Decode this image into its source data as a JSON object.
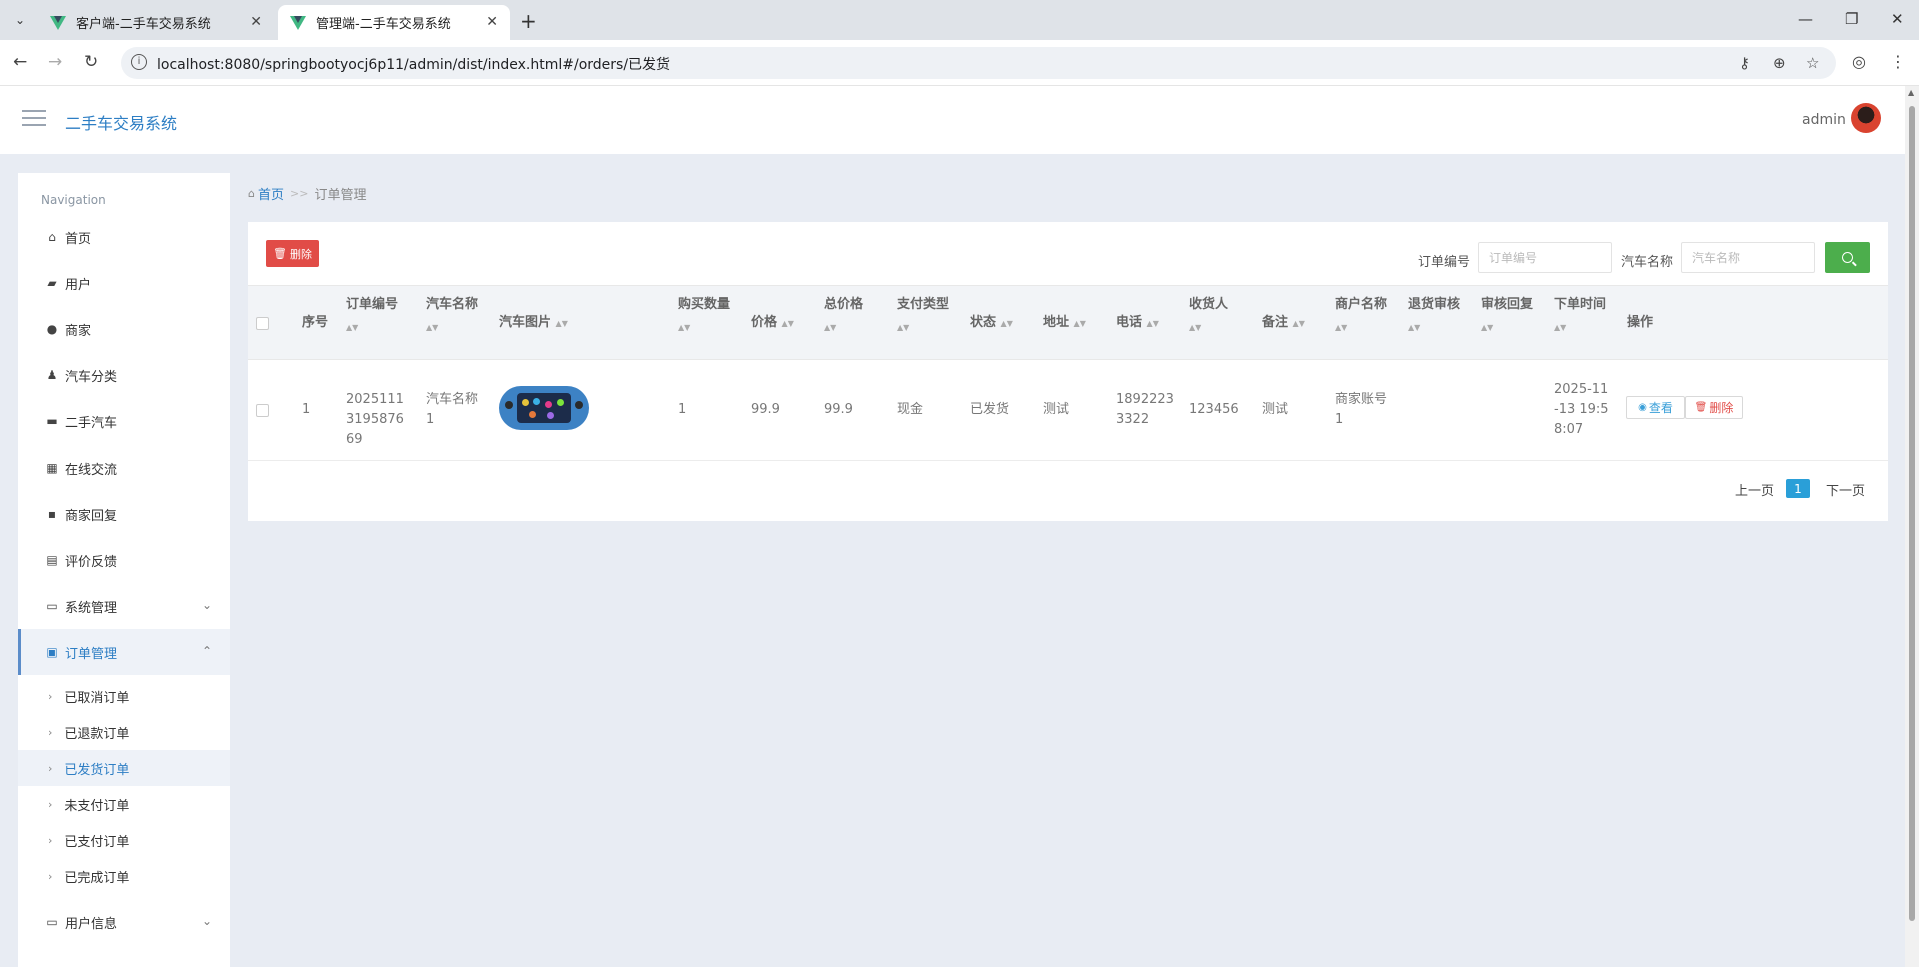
{
  "browser": {
    "tabs": [
      {
        "title": "客户端-二手车交易系统"
      },
      {
        "title": "管理端-二手车交易系统"
      }
    ],
    "url": "localhost:8080/springbootyocj6p11/admin/dist/index.html#/orders/已发货"
  },
  "header": {
    "app_title": "二手车交易系统",
    "user_name": "admin"
  },
  "sidebar": {
    "heading": "Navigation",
    "items": [
      {
        "label": "首页",
        "icon": "home-icon"
      },
      {
        "label": "用户",
        "icon": "briefcase-icon"
      },
      {
        "label": "商家",
        "icon": "globe-icon"
      },
      {
        "label": "汽车分类",
        "icon": "person-icon"
      },
      {
        "label": "二手汽车",
        "icon": "projector-icon"
      },
      {
        "label": "在线交流",
        "icon": "grid-icon"
      },
      {
        "label": "商家回复",
        "icon": "comment-icon"
      },
      {
        "label": "评价反馈",
        "icon": "clipboard-icon"
      },
      {
        "label": "系统管理",
        "icon": "laptop-icon"
      },
      {
        "label": "订单管理",
        "icon": "monitor-icon"
      },
      {
        "label": "用户信息",
        "icon": "card-icon"
      }
    ],
    "order_subitems": [
      "已取消订单",
      "已退款订单",
      "已发货订单",
      "未支付订单",
      "已支付订单",
      "已完成订单"
    ]
  },
  "breadcrumb": {
    "home": "首页",
    "separator": ">>",
    "current": "订单管理"
  },
  "toolbar": {
    "delete_label": "删除",
    "order_no_label": "订单编号",
    "order_no_placeholder": "订单编号",
    "car_name_label": "汽车名称",
    "car_name_placeholder": "汽车名称"
  },
  "table": {
    "columns": [
      "序号",
      "订单编号",
      "汽车名称",
      "汽车图片",
      "购买数量",
      "价格",
      "总价格",
      "支付类型",
      "状态",
      "地址",
      "电话",
      "收货人",
      "备注",
      "商户名称",
      "退货审核",
      "审核回复",
      "下单时间",
      "操作"
    ],
    "rows": [
      {
        "index": "1",
        "order_no": "2025111319587669",
        "car_name": "汽车名称1",
        "quantity": "1",
        "price": "99.9",
        "total": "99.9",
        "pay_type": "现金",
        "status": "已发货",
        "address": "测试",
        "phone": "18922233322",
        "receiver": "123456",
        "remark": "测试",
        "merchant": "商家账号1",
        "return_review": "",
        "review_reply": "",
        "order_time": "2025-11-13 19:58:07",
        "view_label": "查看",
        "delete_label": "删除"
      }
    ]
  },
  "pagination": {
    "prev": "上一页",
    "current": "1",
    "next": "下一页"
  },
  "colors": {
    "accent": "#2d7ec4",
    "danger": "#e14c47",
    "success": "#4cae4c",
    "page_active": "#2a9fd8"
  }
}
